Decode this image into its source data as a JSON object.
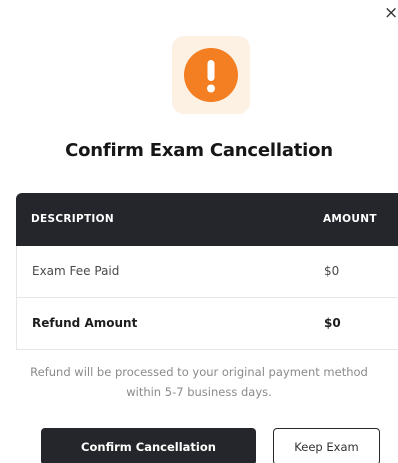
{
  "dialog": {
    "close_label": "×",
    "title": "Confirm Exam Cancellation",
    "icon": "exclamation-warning-icon",
    "accent_color": "#f47e22",
    "icon_bg_color": "#fdf1e4"
  },
  "table": {
    "headers": {
      "description": "DESCRIPTION",
      "amount": "AMOUNT"
    },
    "rows": [
      {
        "description": "Exam Fee Paid",
        "amount": "$0"
      },
      {
        "description": "Refund Amount",
        "amount": "$0"
      }
    ],
    "header_bg_color": "#24262b"
  },
  "note": {
    "line1": "Refund will be processed to your original payment method",
    "line2": "within 5-7 business days."
  },
  "actions": {
    "confirm_label": "Confirm Cancellation",
    "keep_label": "Keep Exam"
  }
}
